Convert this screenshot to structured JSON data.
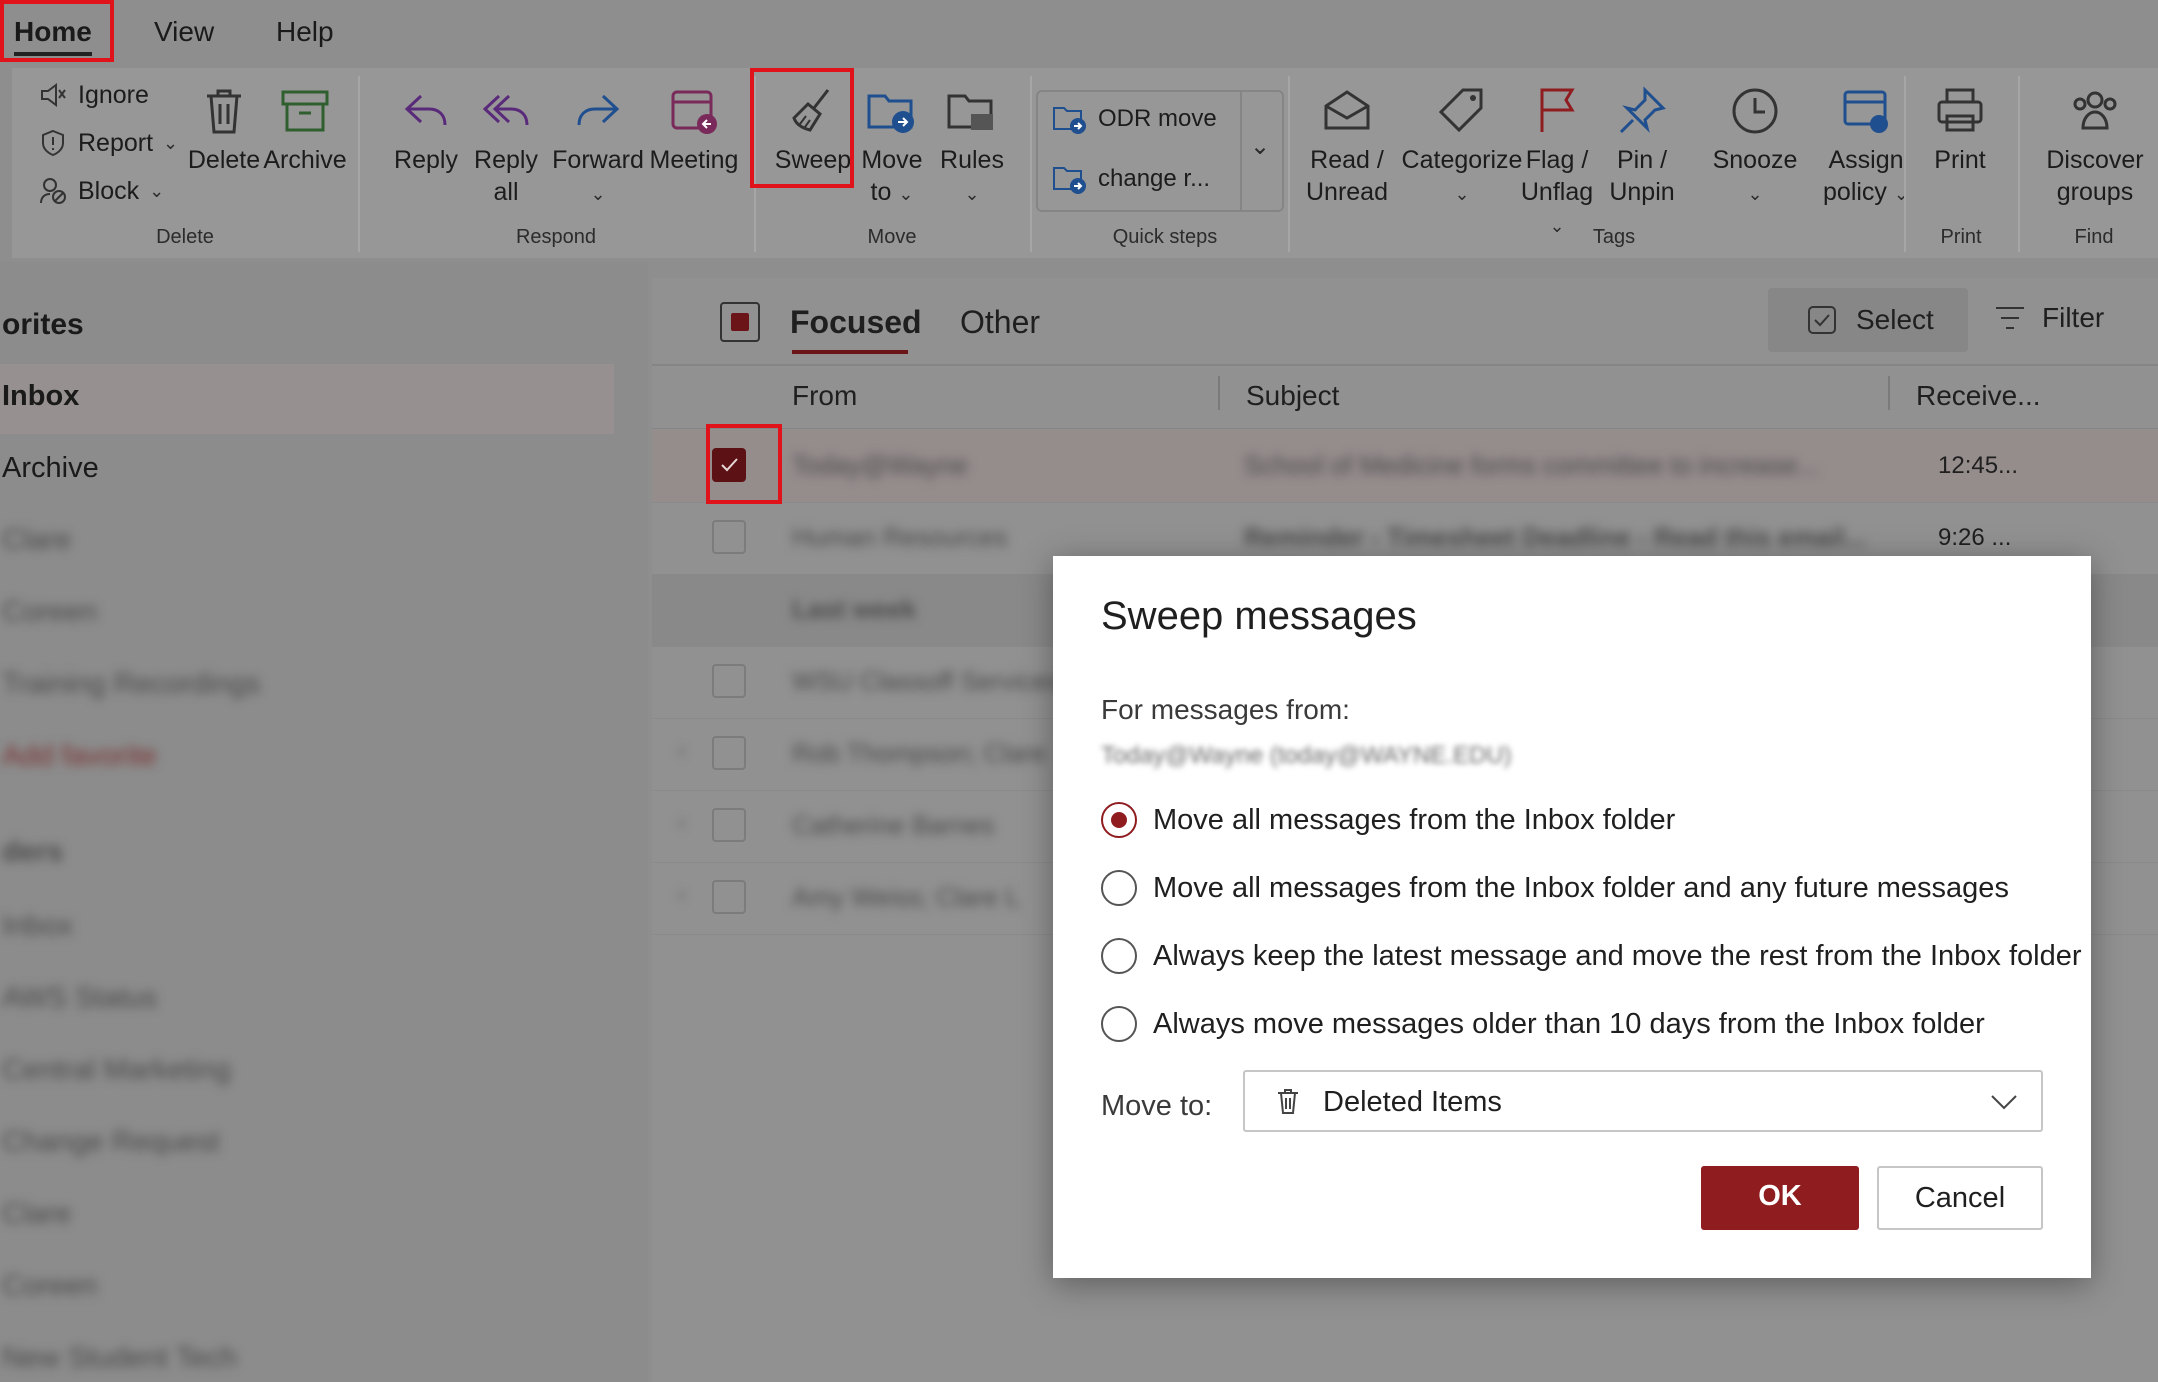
{
  "tabs": {
    "home": "Home",
    "view": "View",
    "help": "Help"
  },
  "ribbon": {
    "delete_group": {
      "ignore": "Ignore",
      "report": "Report",
      "block": "Block",
      "delete": "Delete",
      "archive": "Archive",
      "label": "Delete"
    },
    "respond_group": {
      "reply": "Reply",
      "reply_all_1": "Reply",
      "reply_all_2": "all",
      "forward": "Forward",
      "meeting": "Meeting",
      "label": "Respond"
    },
    "move_group": {
      "sweep": "Sweep",
      "move_to_1": "Move",
      "move_to_2": "to",
      "rules": "Rules",
      "label": "Move"
    },
    "quick_steps": {
      "item1": "ODR move",
      "item2": "change r...",
      "label": "Quick steps"
    },
    "tags_group": {
      "read_1": "Read /",
      "read_2": "Unread",
      "categorize": "Categorize",
      "flag_1": "Flag /",
      "flag_2": "Unflag",
      "pin_1": "Pin /",
      "pin_2": "Unpin",
      "snooze": "Snooze",
      "assign_1": "Assign",
      "assign_2": "policy",
      "label": "Tags"
    },
    "print_group": {
      "print": "Print",
      "label": "Print"
    },
    "find_group": {
      "discover_1": "Discover",
      "discover_2": "groups",
      "label": "Find"
    }
  },
  "sidebar": {
    "favorites": "orites",
    "items": [
      "Inbox",
      "Archive",
      "Clare",
      "Coreen",
      "Training Recordings",
      "Add favorite"
    ],
    "folders_header": "ders",
    "folders": [
      "Inbox",
      "AWS Status",
      "Central Marketing",
      "Change Request",
      "Clare",
      "Coreen",
      "New Student Tech"
    ]
  },
  "maillist": {
    "tab_focused": "Focused",
    "tab_other": "Other",
    "select": "Select",
    "filter": "Filter",
    "col_from": "From",
    "col_subject": "Subject",
    "col_received": "Receive...",
    "rows": [
      {
        "from": "Today@Wayne",
        "subject": "School of Medicine forms committee to increase...",
        "time": "12:45..."
      },
      {
        "from": "Human Resources",
        "subject": "Reminder - Timesheet Deadline - Read this email...",
        "time": "9:26 ..."
      },
      {
        "from": "Last week",
        "subject": "",
        "time": ""
      },
      {
        "from": "WSU Classoff Services",
        "subject": "",
        "time": ""
      },
      {
        "from": "Rob Thompson; Clare",
        "subject": "",
        "time": ""
      },
      {
        "from": "Catherine Barnes",
        "subject": "",
        "time": ""
      },
      {
        "from": "Amy Weiss; Clare L",
        "subject": "",
        "time": ""
      }
    ]
  },
  "dialog": {
    "title": "Sweep messages",
    "for_label": "For messages from:",
    "sender": "Today@Wayne (today@WAYNE.EDU)",
    "options": [
      "Move all messages from the Inbox folder",
      "Move all messages from the Inbox folder and any future messages",
      "Always keep the latest message and move the rest from the Inbox folder",
      "Always move messages older than 10 days from the Inbox folder"
    ],
    "selected_option": 0,
    "move_to_label": "Move to:",
    "move_to_value": "Deleted Items",
    "ok": "OK",
    "cancel": "Cancel"
  },
  "colors": {
    "accent": "#8f1d20",
    "highlight_box": "#e0121a",
    "overlay": "#8e8e8e"
  }
}
